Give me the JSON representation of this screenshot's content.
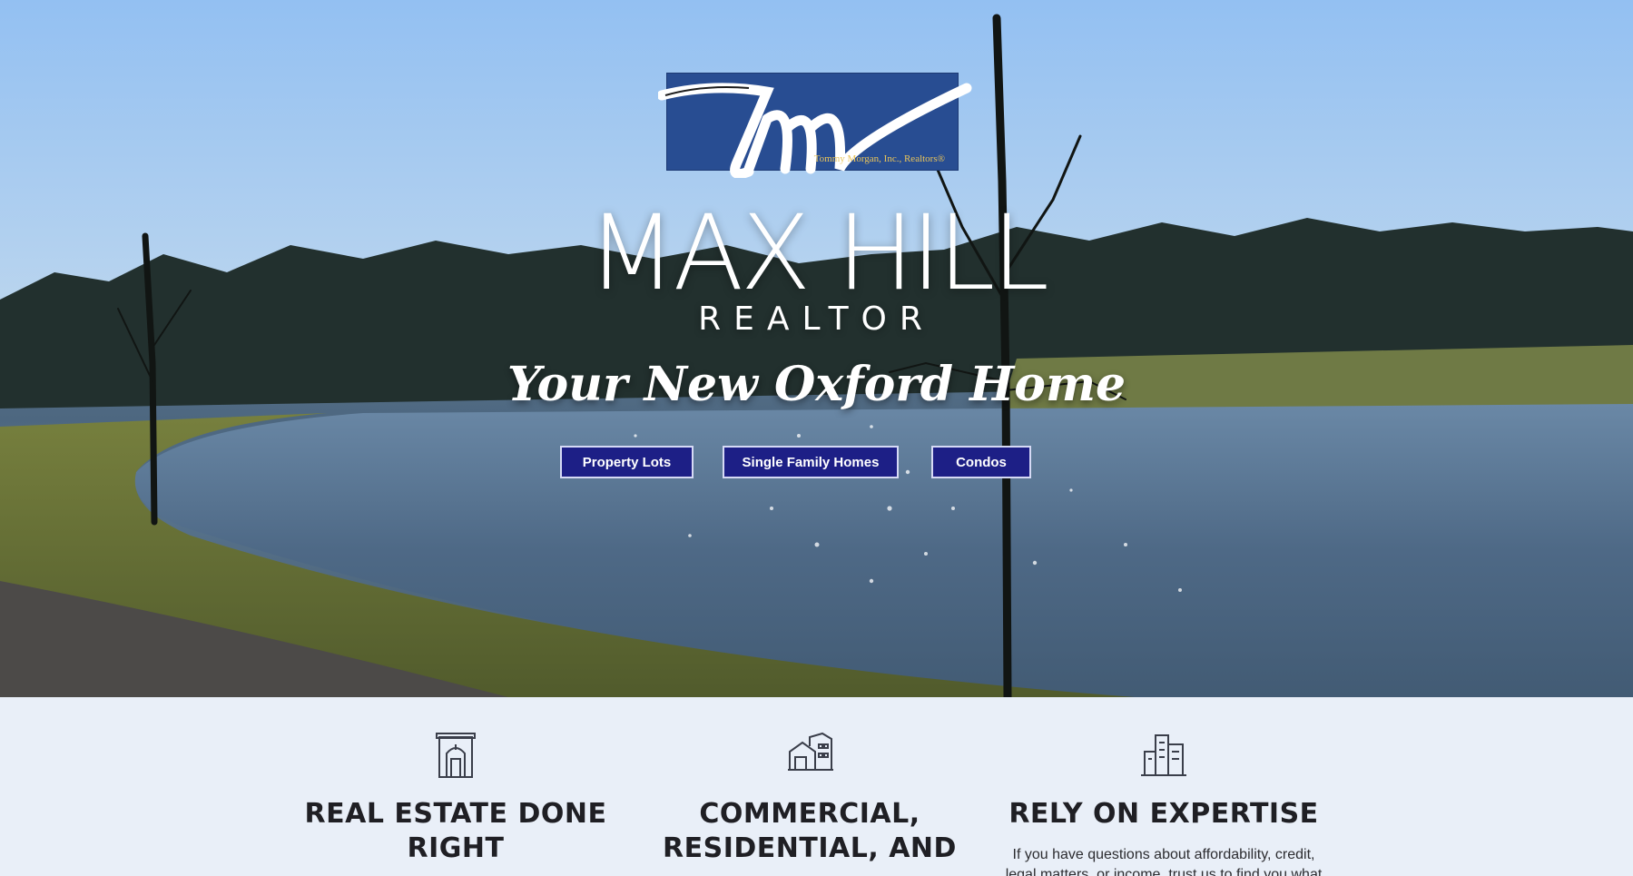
{
  "logo": {
    "script_text": "tm",
    "tagline": "Tommy Morgan, Inc., Realtors®"
  },
  "hero": {
    "title": "MAX HILL",
    "subtitle": "REALTOR",
    "tagline": "Your New Oxford Home"
  },
  "buttons": {
    "property_lots": "Property Lots",
    "single_family": "Single Family Homes",
    "condos": "Condos"
  },
  "features": [
    {
      "icon": "door-building-icon",
      "title": "REAL ESTATE DONE RIGHT",
      "text": ""
    },
    {
      "icon": "house-icon",
      "title": "COMMERCIAL, RESIDENTIAL, AND",
      "text": ""
    },
    {
      "icon": "city-buildings-icon",
      "title": "RELY ON EXPERTISE",
      "text": "If you have questions about affordability, credit, legal matters, or income, trust us to find you what"
    }
  ],
  "colors": {
    "button_bg": "#1d1f86",
    "logo_bg": "#284d92",
    "features_bg": "#e9eff8",
    "heading_text": "#1f1f24"
  }
}
